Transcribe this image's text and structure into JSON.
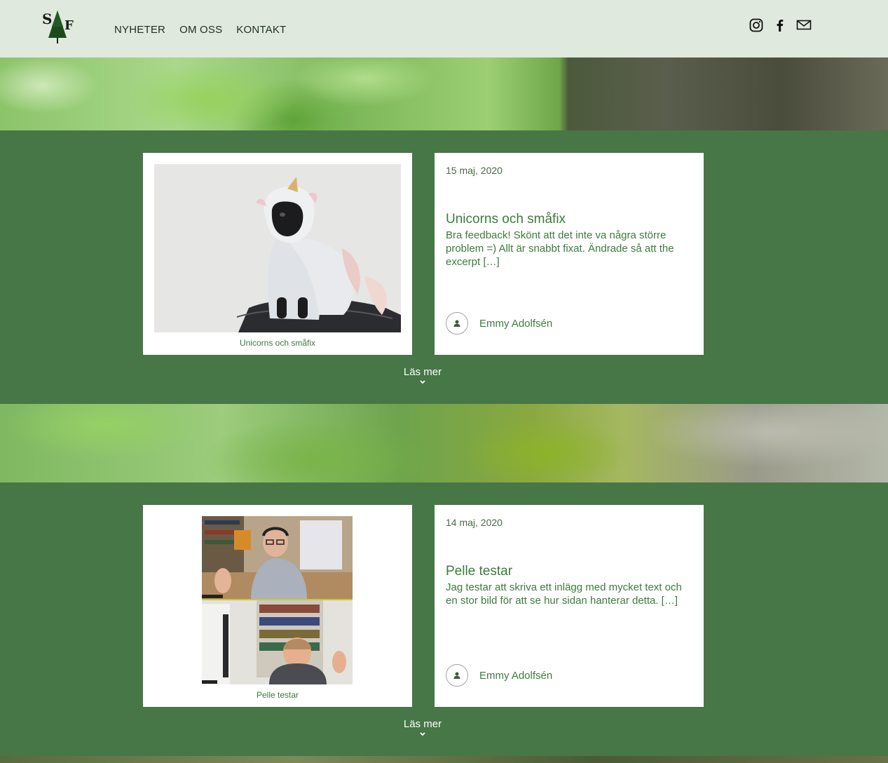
{
  "site": {
    "logo_name": "SF tree logo",
    "logo_letters": "SF"
  },
  "nav": {
    "items": [
      {
        "label": "NYHETER"
      },
      {
        "label": "OM OSS"
      },
      {
        "label": "KONTAKT"
      }
    ]
  },
  "social": {
    "icons": [
      "instagram-icon",
      "facebook-icon",
      "mail-icon"
    ]
  },
  "posts": [
    {
      "image_caption": "Unicorns och småfix",
      "date": "15 maj, 2020",
      "title": "Unicorns och småfix",
      "excerpt": "Bra feedback! Skönt att det inte va några större problem =) Allt är snabbt fixat. Ändrade så att the excerpt […]",
      "author": "Emmy Adolfsén",
      "read_more": "Läs mer"
    },
    {
      "image_caption": "Pelle testar",
      "date": "14 maj, 2020",
      "title": "Pelle testar",
      "excerpt": "Jag testar att skriva ett inlägg med mycket text och en stor bild för att se hur sidan hanterar detta. […]",
      "author": "Emmy Adolfsén",
      "read_more": "Läs mer"
    }
  ],
  "colors": {
    "header_bg": "#dfe9dd",
    "page_bg": "#477647",
    "accent_text": "#3f7a3f"
  }
}
